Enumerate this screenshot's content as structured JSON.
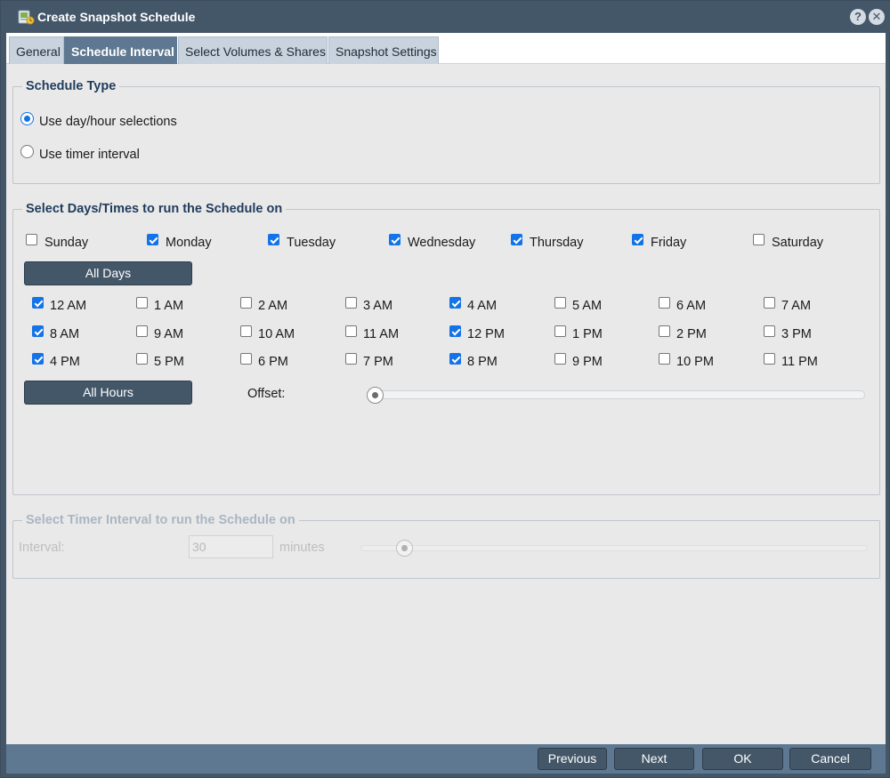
{
  "window": {
    "title": "Create Snapshot Schedule",
    "icon": "snapshot-schedule-icon",
    "help_icon": "?",
    "close_icon": "✕"
  },
  "tabs": [
    {
      "label": "General",
      "active": false
    },
    {
      "label": "Schedule Interval",
      "active": true
    },
    {
      "label": "Select Volumes & Shares",
      "active": false
    },
    {
      "label": "Snapshot Settings",
      "active": false
    }
  ],
  "schedule_type": {
    "legend": "Schedule Type",
    "options": [
      {
        "label": "Use day/hour selections",
        "selected": true
      },
      {
        "label": "Use timer interval",
        "selected": false
      }
    ]
  },
  "days_times": {
    "legend": "Select Days/Times to run the Schedule on",
    "days": [
      {
        "label": "Sunday",
        "checked": false
      },
      {
        "label": "Monday",
        "checked": true
      },
      {
        "label": "Tuesday",
        "checked": true
      },
      {
        "label": "Wednesday",
        "checked": true
      },
      {
        "label": "Thursday",
        "checked": true
      },
      {
        "label": "Friday",
        "checked": true
      },
      {
        "label": "Saturday",
        "checked": false
      }
    ],
    "all_days_label": "All Days",
    "hours": [
      {
        "label": "12 AM",
        "checked": true
      },
      {
        "label": "1 AM",
        "checked": false
      },
      {
        "label": "2 AM",
        "checked": false
      },
      {
        "label": "3 AM",
        "checked": false
      },
      {
        "label": "4 AM",
        "checked": true
      },
      {
        "label": "5 AM",
        "checked": false
      },
      {
        "label": "6 AM",
        "checked": false
      },
      {
        "label": "7 AM",
        "checked": false
      },
      {
        "label": "8 AM",
        "checked": true
      },
      {
        "label": "9 AM",
        "checked": false
      },
      {
        "label": "10 AM",
        "checked": false
      },
      {
        "label": "11 AM",
        "checked": false
      },
      {
        "label": "12 PM",
        "checked": true
      },
      {
        "label": "1 PM",
        "checked": false
      },
      {
        "label": "2 PM",
        "checked": false
      },
      {
        "label": "3 PM",
        "checked": false
      },
      {
        "label": "4 PM",
        "checked": true
      },
      {
        "label": "5 PM",
        "checked": false
      },
      {
        "label": "6 PM",
        "checked": false
      },
      {
        "label": "7 PM",
        "checked": false
      },
      {
        "label": "8 PM",
        "checked": true
      },
      {
        "label": "9 PM",
        "checked": false
      },
      {
        "label": "10 PM",
        "checked": false
      },
      {
        "label": "11 PM",
        "checked": false
      }
    ],
    "all_hours_label": "All Hours",
    "offset_label": "Offset:",
    "offset_value": 0
  },
  "timer_interval": {
    "legend": "Select Timer Interval to run the Schedule on",
    "interval_label": "Interval:",
    "interval_value": "30",
    "units_label": "minutes",
    "disabled": true
  },
  "footer": {
    "previous_label": "Previous",
    "next_label": "Next",
    "ok_label": "OK",
    "cancel_label": "Cancel"
  },
  "colors": {
    "titlebar": "#445769",
    "active_tab": "#5e7891",
    "accent": "#1473e6",
    "panel_bg": "#e9e9e9"
  }
}
